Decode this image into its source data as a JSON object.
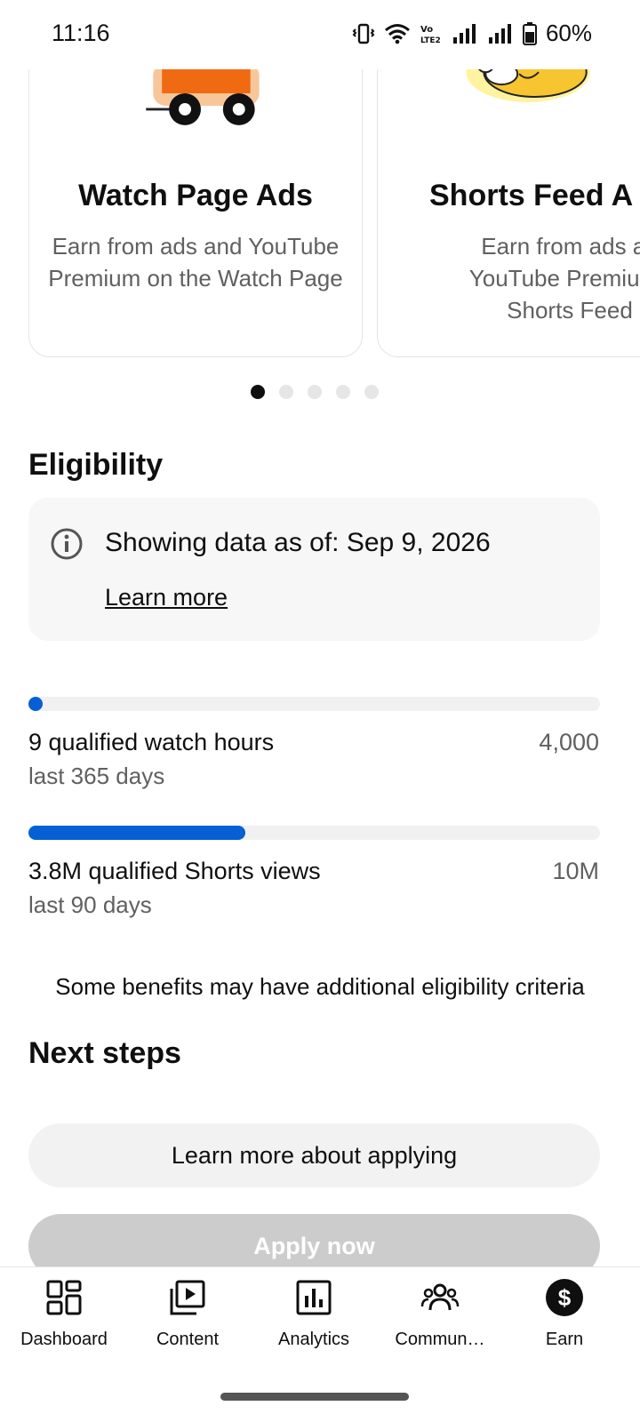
{
  "status_bar": {
    "time": "11:16",
    "battery": "60%",
    "icons": [
      "vibrate-icon",
      "wifi-icon",
      "volte-icon",
      "signal-icon",
      "signal-icon",
      "battery-icon"
    ]
  },
  "carousel": {
    "cards": [
      {
        "title": "Watch Page Ads",
        "description": "Earn from ads and YouTube Premium on the Watch Page",
        "illustration": "car-illustration"
      },
      {
        "title": "Shorts Feed A",
        "description_lines": [
          "Earn from ads an",
          "YouTube Premium i",
          "Shorts Feed"
        ],
        "illustration": "character-illustration"
      }
    ],
    "page_count": 5,
    "active_page": 1
  },
  "eligibility": {
    "title": "Eligibility",
    "info_text": "Showing data as of: Sep 9, 2026",
    "learn_more": "Learn more",
    "metrics": [
      {
        "label": "9 qualified watch hours",
        "sublabel": "last 365 days",
        "target": "4,000",
        "progress": 0.0025
      },
      {
        "label": "3.8M qualified Shorts views",
        "sublabel": "last 90 days",
        "target": "10M",
        "progress": 0.38
      }
    ],
    "note": "Some benefits may have additional eligibility criteria"
  },
  "next_steps": {
    "title": "Next steps",
    "learn_button": "Learn more about applying",
    "apply_button": "Apply now"
  },
  "nav": {
    "items": [
      {
        "label": "Dashboard",
        "icon": "dashboard-icon"
      },
      {
        "label": "Content",
        "icon": "content-icon"
      },
      {
        "label": "Analytics",
        "icon": "analytics-icon"
      },
      {
        "label": "Commun…",
        "icon": "community-icon"
      },
      {
        "label": "Earn",
        "icon": "earn-icon",
        "active": true
      }
    ]
  },
  "colors": {
    "accent": "#065fd4",
    "disabled_button": "#cccccc",
    "secondary_text": "#606060"
  }
}
